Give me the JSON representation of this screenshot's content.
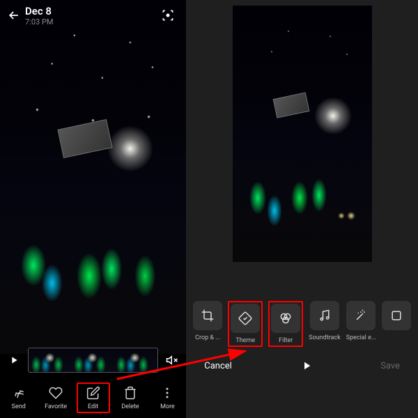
{
  "header": {
    "date": "Dec 8",
    "time": "7:03 PM"
  },
  "left_actions": {
    "send": "Send",
    "favorite": "Favorite",
    "edit": "Edit",
    "delete": "Delete",
    "more": "More"
  },
  "edit_tools": {
    "crop": "Crop & ...",
    "theme": "Theme",
    "filter": "Filter",
    "soundtrack": "Soundtrack",
    "special": "Special e..."
  },
  "right_footer": {
    "cancel": "Cancel",
    "save": "Save"
  },
  "colors": {
    "annotation": "#ff0000",
    "bg_dark": "#000000",
    "bg_mid": "#1f1f1f",
    "tool_bg": "#333333"
  }
}
